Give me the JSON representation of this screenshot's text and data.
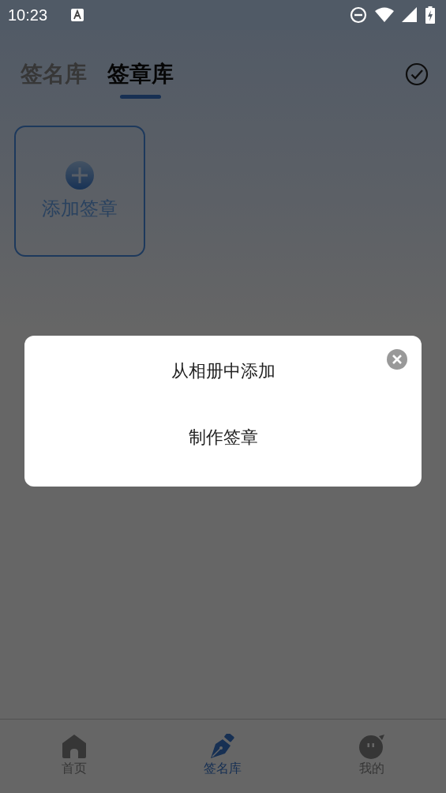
{
  "status_bar": {
    "time": "10:23"
  },
  "tabs": [
    {
      "label": "签名库",
      "selected": false
    },
    {
      "label": "签章库",
      "selected": true
    }
  ],
  "add_card": {
    "label": "添加签章"
  },
  "dialog": {
    "options": [
      "从相册中添加",
      "制作签章"
    ]
  },
  "bottom_nav": [
    {
      "label": "首页",
      "kind": "home",
      "selected": false
    },
    {
      "label": "签名库",
      "kind": "pen",
      "selected": true
    },
    {
      "label": "我的",
      "kind": "face",
      "selected": false
    }
  ]
}
